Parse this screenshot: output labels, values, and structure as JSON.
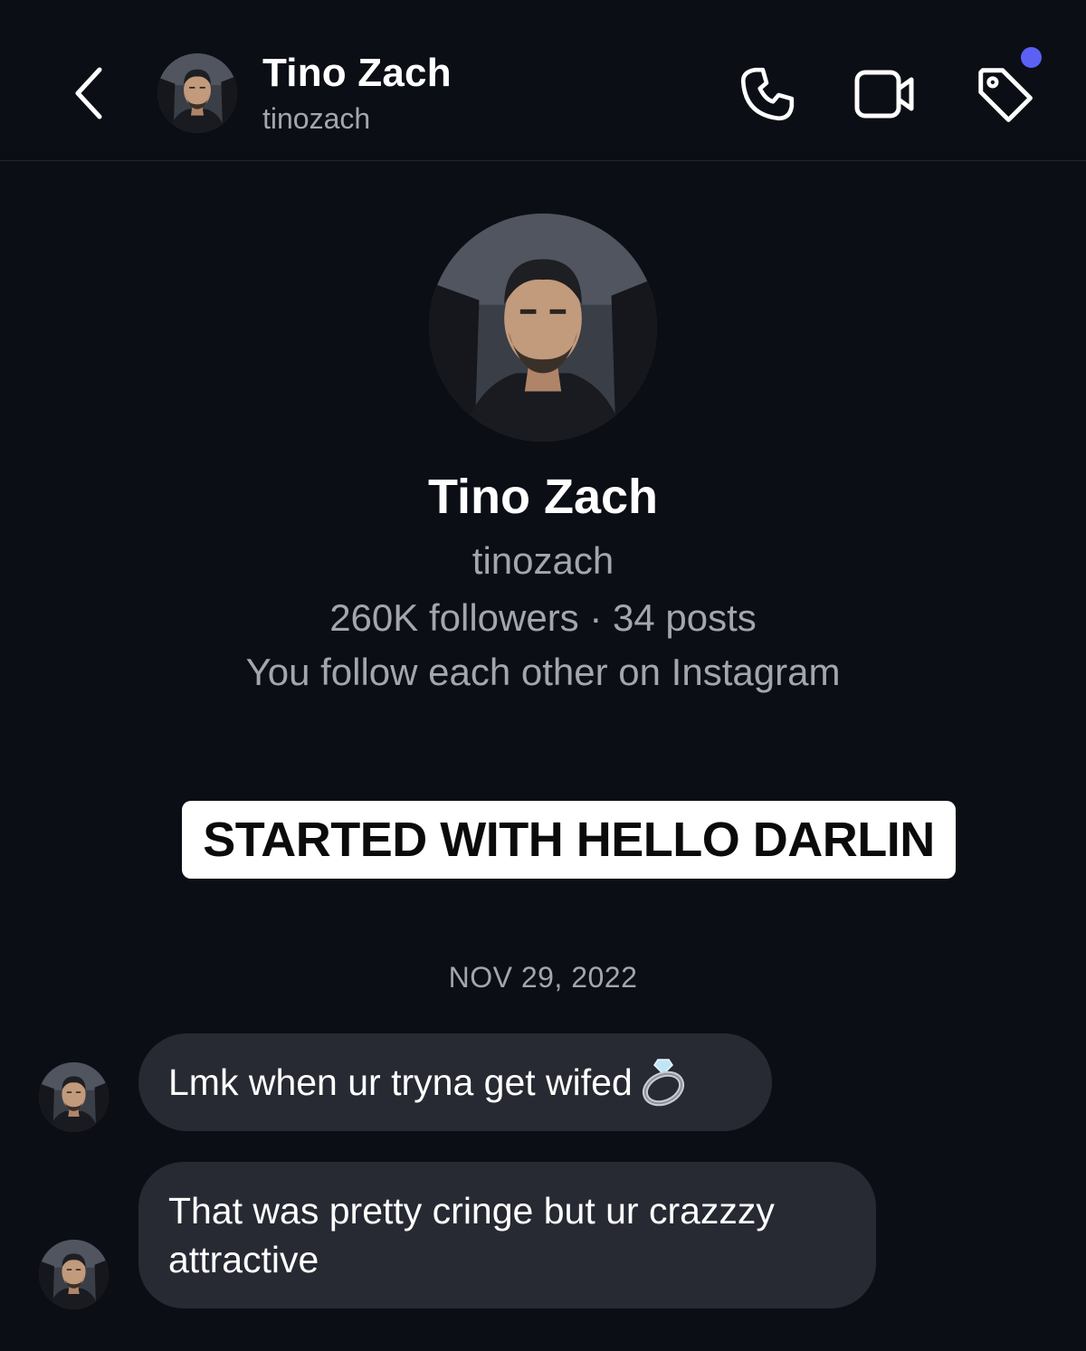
{
  "header": {
    "name": "Tino Zach",
    "username": "tinozach",
    "icons": [
      "back-chevron-icon",
      "phone-icon",
      "video-camera-icon",
      "tag-icon"
    ],
    "notification_dot_color": "#5b61f5"
  },
  "profile": {
    "name": "Tino Zach",
    "username": "tinozach",
    "stats": "260K followers · 34 posts",
    "mutual": "You follow each other on Instagram"
  },
  "caption": "STARTED WITH HELLO DARLIN",
  "date_separator": "NOV 29, 2022",
  "messages": [
    {
      "text": "Lmk when ur tryna get wifed",
      "emoji": "ring-icon"
    },
    {
      "text": "That was pretty cringe but ur crazzzy attractive"
    }
  ],
  "colors": {
    "background": "#0c0e16",
    "bubble": "#272a32",
    "secondary_text": "#a4a6ae"
  }
}
